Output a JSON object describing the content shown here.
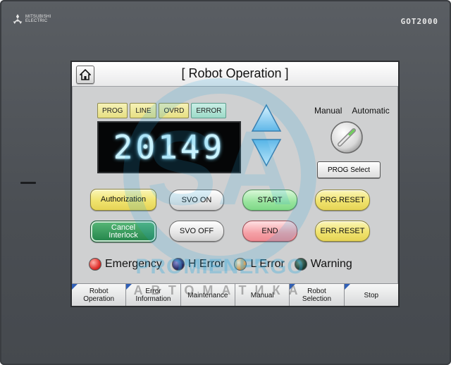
{
  "device": {
    "brand_line1": "MITSUBISHI",
    "brand_line2": "ELECTRIC",
    "model": "GOT2000"
  },
  "header": {
    "title": "[ Robot Operation ]",
    "home_icon": "home-icon"
  },
  "indicators": [
    {
      "label": "PROG"
    },
    {
      "label": "LINE"
    },
    {
      "label": "OVRD"
    },
    {
      "label": "ERROR"
    }
  ],
  "counter": {
    "value": "20149"
  },
  "mode": {
    "manual_label": "Manual",
    "automatic_label": "Automatic",
    "prog_select_label": "PROG  Select"
  },
  "buttons": {
    "authorization": "Authorization",
    "cancel_interlock_line1": "Cancel",
    "cancel_interlock_line2": "Interlock",
    "svo_on": "SVO   ON",
    "svo_off": "SVO   OFF",
    "start": "START",
    "end": "END",
    "prog_reset": "PRG.RESET",
    "err_reset": "ERR.RESET"
  },
  "status_lamps": [
    {
      "label": "Emergency",
      "color": "#e0322e"
    },
    {
      "label": "H Error",
      "color": "#2b2f6b"
    },
    {
      "label": "L Error",
      "color": "#f2a34a"
    },
    {
      "label": "Warning",
      "color": "#21443a"
    }
  ],
  "tabs": [
    {
      "line1": "Robot",
      "line2": "Operation"
    },
    {
      "line1": "Error",
      "line2": "Information"
    },
    {
      "line1": "Maintenance",
      "line2": ""
    },
    {
      "line1": "Manual",
      "line2": ""
    },
    {
      "line1": "Robot",
      "line2": "Selection"
    },
    {
      "line1": "Stop",
      "line2": ""
    }
  ],
  "watermark": {
    "line1": "PROMIENERGO",
    "line2": "АВТОМАТИКА"
  }
}
